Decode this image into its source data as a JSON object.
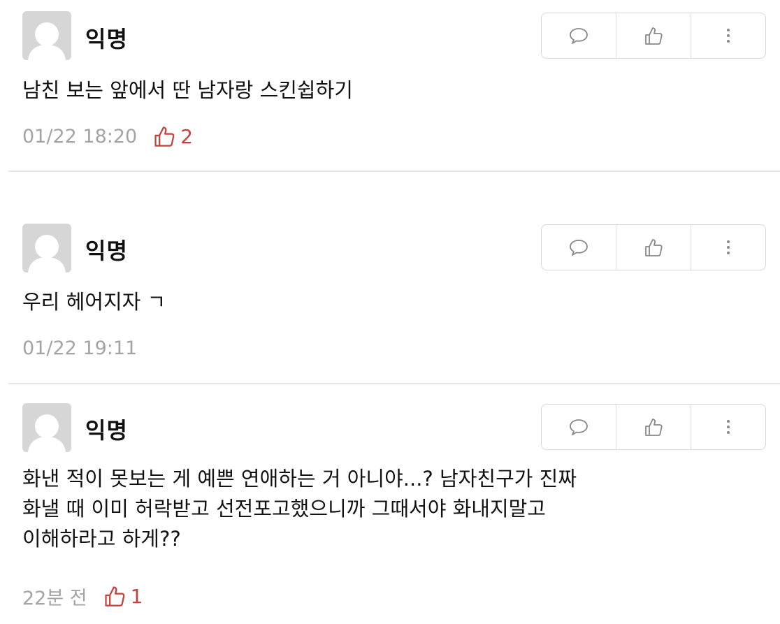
{
  "comments": [
    {
      "author": "익명",
      "text": "남친 보는 앞에서 딴 남자랑 스킨쉽하기",
      "time": "01/22 18:20",
      "likes": "2"
    },
    {
      "author": "익명",
      "text": "우리 헤어지자 ㄱ",
      "time": "01/22 19:11",
      "likes": ""
    },
    {
      "author": "익명",
      "text": "화낸 적이 못보는 게 예쁜 연애하는 거 아니야...? 남자친구가 진짜\n화낼 때 이미 허락받고 선전포고했으니까 그때서야 화내지말고\n이해하라고 하게??",
      "time": "22분 전",
      "likes": "1"
    }
  ],
  "icons": {
    "comment": "speech-bubble-icon",
    "like": "thumbs-up-icon",
    "more": "vertical-dots-icon"
  },
  "colors": {
    "like_count": "#c6413c",
    "meta_text": "#a4a4a4",
    "avatar_bg": "#d6d6d6"
  }
}
